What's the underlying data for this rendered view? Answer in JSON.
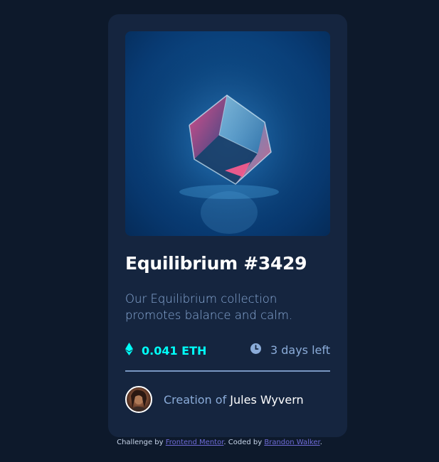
{
  "card": {
    "title": "Equilibrium #3429",
    "description": "Our Equilibrium collection promotes balance and calm.",
    "price": "0.041 ETH",
    "time_left": "3 days left",
    "creator_prefix": "Creation of ",
    "creator_name": "Jules Wyvern"
  },
  "attribution": {
    "prefix": "Challenge by ",
    "challenge_link": "Frontend Mentor",
    "middle": ". Coded by ",
    "author_link": "Brandon Walker",
    "suffix": "."
  },
  "icons": {
    "price": "ethereum-icon",
    "time": "clock-icon"
  },
  "colors": {
    "background": "#0d192b",
    "card": "#15253f",
    "accent": "#00fff8",
    "muted_text": "#8bacd9",
    "white": "#ffffff",
    "link": "#6e6bd6"
  }
}
